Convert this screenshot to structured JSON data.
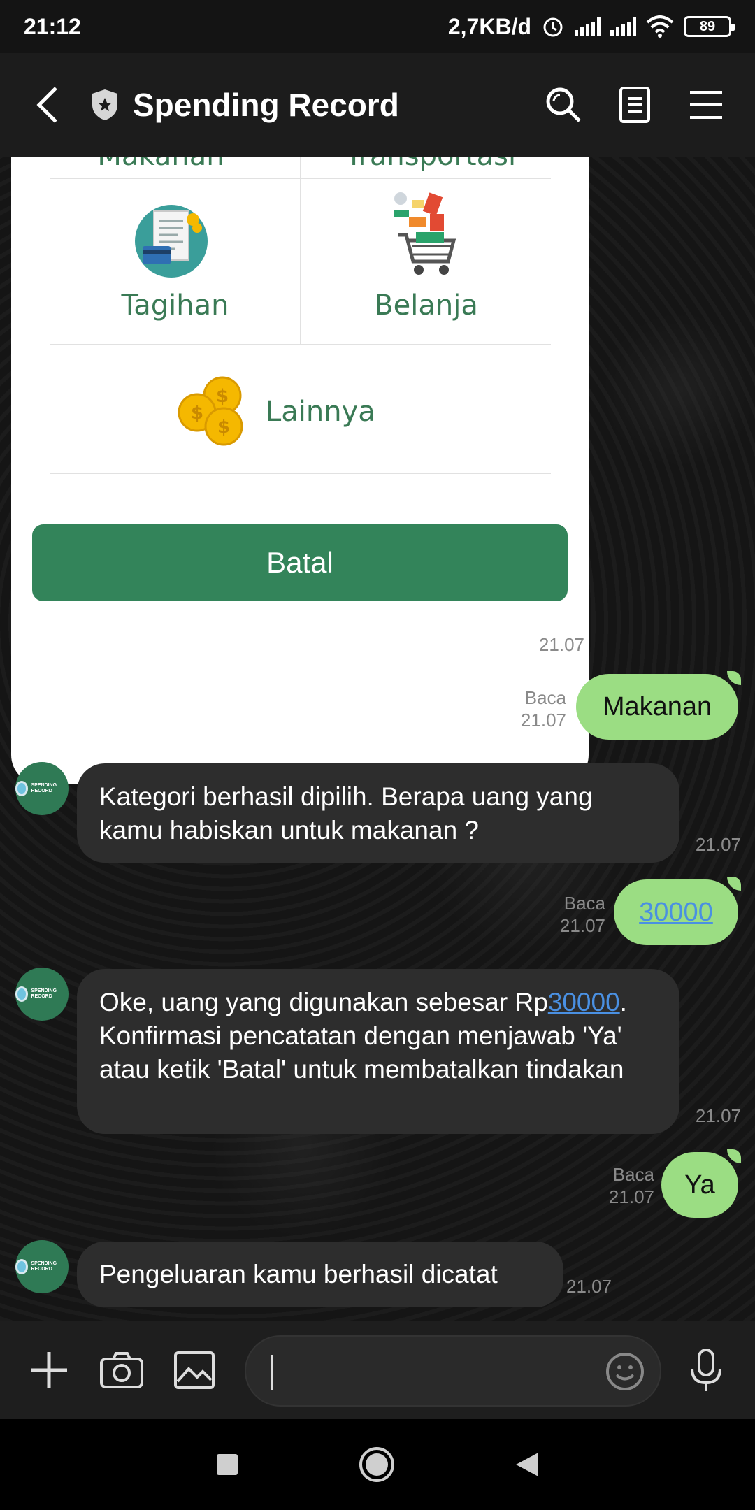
{
  "status_bar": {
    "time": "21:12",
    "speed": "2,7KB/d",
    "battery": "89"
  },
  "header": {
    "title": "Spending Record"
  },
  "card": {
    "partial_categories": [
      "Makanan",
      "Transportasi"
    ],
    "categories": [
      {
        "label": "Tagihan",
        "icon": "bill-icon"
      },
      {
        "label": "Belanja",
        "icon": "shopping-cart-icon"
      },
      {
        "label": "Lainnya",
        "icon": "coins-icon"
      }
    ],
    "cancel_label": "Batal"
  },
  "messages": [
    {
      "side": "out",
      "text": "Makanan",
      "read": "Baca",
      "time": "21.07"
    },
    {
      "side": "in",
      "text": "Kategori berhasil dipilih. Berapa uang yang kamu habiskan untuk makanan ?",
      "time": "21.07"
    },
    {
      "side": "out",
      "text": "30000",
      "read": "Baca",
      "time": "21.07"
    },
    {
      "side": "in",
      "text_before": "Oke, uang yang digunakan sebesar Rp",
      "link": "30000",
      "text_after": ". Konfirmasi pencatatan dengan menjawab 'Ya' atau ketik 'Batal' untuk membatalkan tindakan",
      "time": "21.07"
    },
    {
      "side": "out",
      "text": "Ya",
      "read": "Baca",
      "time": "21.07"
    },
    {
      "side": "in",
      "text": "Pengeluaran kamu berhasil dicatat",
      "time": "21.07"
    }
  ],
  "card_time": "21.07",
  "avatar_text": "SPENDING RECORD",
  "colors": {
    "accent_green": "#33845a",
    "bubble_out": "#9bdd83",
    "bubble_in": "#2d2d2d",
    "category_text": "#3a7a55"
  }
}
